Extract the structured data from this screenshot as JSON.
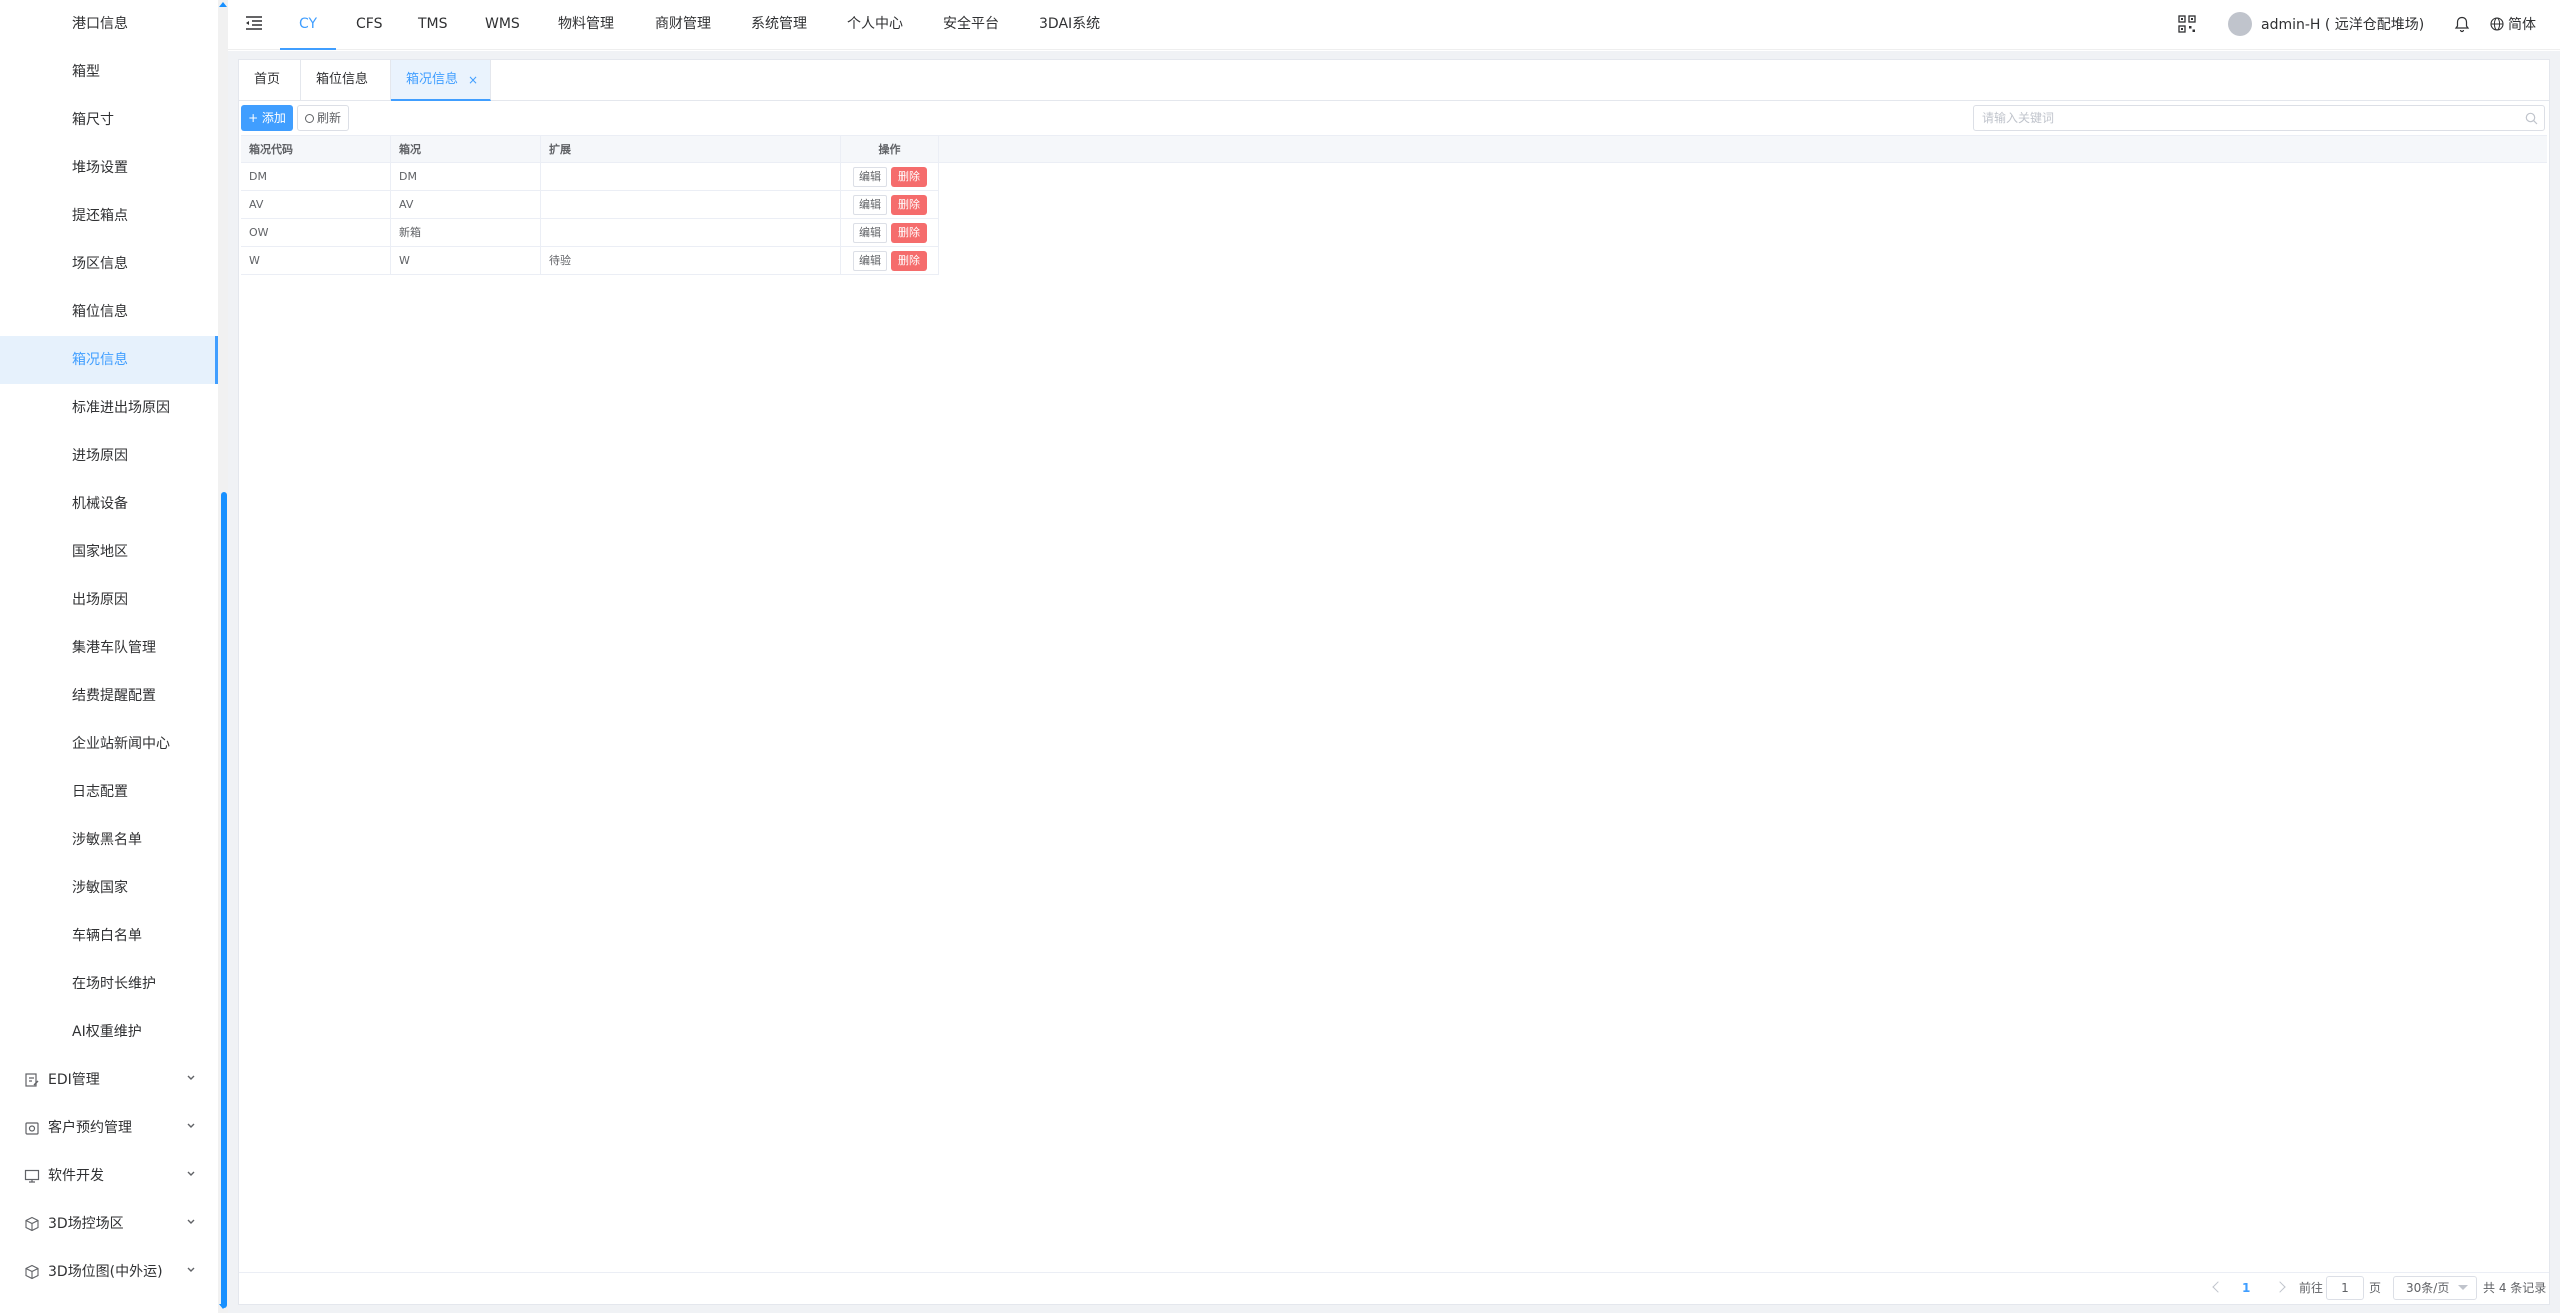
{
  "sidebar": {
    "items": [
      {
        "label": "港口信息",
        "active": false
      },
      {
        "label": "箱型",
        "active": false
      },
      {
        "label": "箱尺寸",
        "active": false
      },
      {
        "label": "堆场设置",
        "active": false
      },
      {
        "label": "提还箱点",
        "active": false
      },
      {
        "label": "场区信息",
        "active": false
      },
      {
        "label": "箱位信息",
        "active": false
      },
      {
        "label": "箱况信息",
        "active": true
      },
      {
        "label": "标准进出场原因",
        "active": false
      },
      {
        "label": "进场原因",
        "active": false
      },
      {
        "label": "机械设备",
        "active": false
      },
      {
        "label": "国家地区",
        "active": false
      },
      {
        "label": "出场原因",
        "active": false
      },
      {
        "label": "集港车队管理",
        "active": false
      },
      {
        "label": "结费提醒配置",
        "active": false
      },
      {
        "label": "企业站新闻中心",
        "active": false
      },
      {
        "label": "日志配置",
        "active": false
      },
      {
        "label": "涉敏黑名单",
        "active": false
      },
      {
        "label": "涉敏国家",
        "active": false
      },
      {
        "label": "车辆白名单",
        "active": false
      },
      {
        "label": "在场时长维护",
        "active": false
      },
      {
        "label": "AI权重维护",
        "active": false
      }
    ],
    "groups": [
      {
        "label": "EDI管理",
        "icon": "edit-doc-icon"
      },
      {
        "label": "客户预约管理",
        "icon": "appointment-icon"
      },
      {
        "label": "软件开发",
        "icon": "monitor-icon"
      },
      {
        "label": "3D场控场区",
        "icon": "cube-icon"
      },
      {
        "label": "3D场位图(中外运)",
        "icon": "cube-icon"
      }
    ]
  },
  "topnav": {
    "items": [
      {
        "label": "CY",
        "active": true
      },
      {
        "label": "CFS",
        "active": false
      },
      {
        "label": "TMS",
        "active": false
      },
      {
        "label": "WMS",
        "active": false
      },
      {
        "label": "物料管理",
        "active": false
      },
      {
        "label": "商财管理",
        "active": false
      },
      {
        "label": "系统管理",
        "active": false
      },
      {
        "label": "个人中心",
        "active": false
      },
      {
        "label": "安全平台",
        "active": false
      },
      {
        "label": "3DAI系统",
        "active": false
      }
    ],
    "user": "admin-H ( 远洋仓配堆场)",
    "lang": "简体"
  },
  "tabs": [
    {
      "label": "首页",
      "active": false,
      "closable": false
    },
    {
      "label": "箱位信息",
      "active": false,
      "closable": false
    },
    {
      "label": "箱况信息",
      "active": true,
      "closable": true
    }
  ],
  "toolbar": {
    "add_label": "+ 添加",
    "refresh_label": "刷新",
    "search_placeholder": "请输入关键词"
  },
  "table": {
    "columns": [
      "箱况代码",
      "箱况",
      "扩展",
      "操作"
    ],
    "rows": [
      {
        "code": "DM",
        "status": "DM",
        "ext": ""
      },
      {
        "code": "AV",
        "status": "AV",
        "ext": ""
      },
      {
        "code": "OW",
        "status": "新箱",
        "ext": ""
      },
      {
        "code": "W",
        "status": "W",
        "ext": "待验"
      }
    ],
    "edit_label": "编辑",
    "delete_label": "删除"
  },
  "pagination": {
    "current_page": "1",
    "goto_label": "前往",
    "goto_value": "1",
    "page_unit": "页",
    "page_size": "30条/页",
    "total": "共 4 条记录"
  },
  "colors": {
    "accent": "#409eff",
    "danger": "#f56c6c",
    "scrollbar": "#1890ff"
  }
}
